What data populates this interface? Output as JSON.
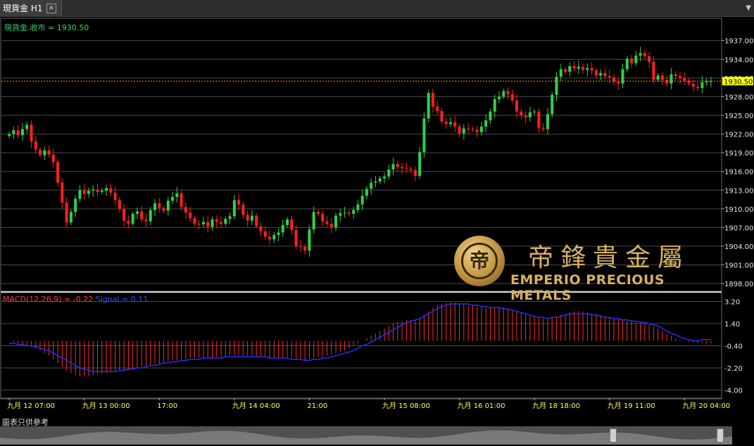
{
  "window": {
    "tab_title": "現貨金 H1",
    "close_glyph": "×",
    "menu_glyph": "▼"
  },
  "legend": {
    "price": "現貨金.收市 = 1930.50",
    "macd": "MACD(12,26,9) = -0.22",
    "signal": "Signal = 0.11"
  },
  "watermark": {
    "logo_glyph": "帝",
    "chinese": "帝鋒貴金屬",
    "english": "EMPERIO PRECIOUS METALS"
  },
  "footer": {
    "note": "圖表只供參考"
  },
  "colors": {
    "up": "#2fd14a",
    "down": "#ff1f1f",
    "grid": "#4a4a4a",
    "axis_text": "#e6e6e6",
    "current_price_bg": "#ffff00",
    "current_price_line": "#ff8c1a",
    "macd_hist": "#ff2a2a",
    "signal_line": "#1f2fff",
    "date_text": "#ffff66"
  },
  "chart_data": [
    {
      "type": "candlestick",
      "title": "現貨金 H1",
      "ylim": [
        1897,
        1939
      ],
      "y_ticks": [
        1937.0,
        1934.0,
        1931.0,
        1928.0,
        1925.0,
        1922.0,
        1919.0,
        1916.0,
        1913.0,
        1910.0,
        1907.0,
        1904.0,
        1901.0,
        1898.0
      ],
      "current_price": 1930.5,
      "current_price_label": "1930.50",
      "x_tick_labels": [
        "九月 12 07:00",
        "九月 13 00:00",
        "17:00",
        "九月 14 04:00",
        "21:00",
        "九月 15 08:00",
        "九月 16 01:00",
        "九月 18 18:00",
        "九月 19 11:00",
        "九月 20 04:00"
      ],
      "x_tick_index": [
        0,
        17,
        34,
        51,
        68,
        85,
        102,
        119,
        136,
        153
      ],
      "closes": [
        1922.0,
        1922.6,
        1921.8,
        1922.8,
        1923.5,
        1920.8,
        1919.5,
        1918.6,
        1919.4,
        1918.7,
        1917.5,
        1914.2,
        1911.0,
        1907.8,
        1909.5,
        1911.6,
        1913.0,
        1912.4,
        1912.9,
        1913.1,
        1912.7,
        1912.9,
        1913.3,
        1912.6,
        1911.4,
        1910.0,
        1908.1,
        1907.6,
        1909.2,
        1909.6,
        1908.3,
        1908.0,
        1909.8,
        1910.9,
        1910.1,
        1909.7,
        1911.3,
        1911.9,
        1912.5,
        1910.3,
        1909.4,
        1908.5,
        1907.6,
        1907.5,
        1907.9,
        1907.1,
        1908.3,
        1907.9,
        1907.6,
        1908.4,
        1908.8,
        1911.4,
        1910.7,
        1909.0,
        1908.1,
        1908.9,
        1907.2,
        1906.4,
        1905.5,
        1905.1,
        1905.8,
        1906.2,
        1907.4,
        1908.3,
        1906.6,
        1904.0,
        1903.9,
        1903.3,
        1906.7,
        1909.5,
        1909.2,
        1908.0,
        1907.6,
        1907.0,
        1908.9,
        1909.3,
        1909.4,
        1909.2,
        1909.8,
        1910.7,
        1912.1,
        1913.2,
        1914.2,
        1914.4,
        1914.9,
        1915.2,
        1916.3,
        1917.2,
        1916.7,
        1916.5,
        1916.4,
        1916.2,
        1915.3,
        1919.1,
        1924.5,
        1928.6,
        1926.4,
        1925.7,
        1924.0,
        1923.6,
        1923.9,
        1923.2,
        1922.1,
        1922.9,
        1922.8,
        1922.7,
        1922.3,
        1923.2,
        1924.2,
        1925.6,
        1927.6,
        1928.0,
        1928.9,
        1928.4,
        1927.4,
        1925.6,
        1925.0,
        1924.7,
        1925.5,
        1925.6,
        1923.0,
        1922.8,
        1925.2,
        1928.3,
        1931.2,
        1932.4,
        1932.0,
        1932.9,
        1932.5,
        1932.8,
        1932.3,
        1932.6,
        1932.2,
        1931.4,
        1931.8,
        1931.3,
        1931.1,
        1930.4,
        1930.1,
        1932.4,
        1934.1,
        1933.4,
        1934.6,
        1935.0,
        1934.5,
        1933.6,
        1930.7,
        1931.4,
        1930.7,
        1930.1,
        1931.6,
        1931.3,
        1931.0,
        1930.6,
        1930.1,
        1929.6,
        1929.4,
        1930.3,
        1930.5,
        1930.5
      ],
      "macd": {
        "ylim": [
          -4.6,
          3.8
        ],
        "y_ticks": [
          3.2,
          1.4,
          -0.4,
          -2.2,
          -4.0
        ],
        "series": [
          {
            "name": "MACD(12,26,9)",
            "values": [
              0.0,
              -0.1,
              -0.2,
              -0.3,
              -0.4,
              -0.5,
              -0.6,
              -0.8,
              -1.0,
              -1.2,
              -1.5,
              -1.8,
              -2.1,
              -2.4,
              -2.6,
              -2.8,
              -2.9,
              -2.9,
              -2.9,
              -2.8,
              -2.7,
              -2.7,
              -2.6,
              -2.5,
              -2.5,
              -2.4,
              -2.4,
              -2.4,
              -2.3,
              -2.2,
              -2.1,
              -2.1,
              -2.0,
              -1.9,
              -1.9,
              -1.8,
              -1.7,
              -1.6,
              -1.6,
              -1.5,
              -1.5,
              -1.4,
              -1.4,
              -1.4,
              -1.4,
              -1.4,
              -1.4,
              -1.3,
              -1.3,
              -1.3,
              -1.2,
              -1.2,
              -1.2,
              -1.2,
              -1.2,
              -1.2,
              -1.3,
              -1.3,
              -1.3,
              -1.4,
              -1.4,
              -1.4,
              -1.4,
              -1.4,
              -1.4,
              -1.5,
              -1.5,
              -1.6,
              -1.5,
              -1.4,
              -1.3,
              -1.3,
              -1.2,
              -1.1,
              -1.0,
              -0.9,
              -0.8,
              -0.6,
              -0.4,
              -0.2,
              0.0,
              0.2,
              0.4,
              0.6,
              0.8,
              1.0,
              1.2,
              1.4,
              1.5,
              1.6,
              1.7,
              1.7,
              1.7,
              1.8,
              2.1,
              2.4,
              2.7,
              2.9,
              3.0,
              3.1,
              3.1,
              3.1,
              3.0,
              3.0,
              2.9,
              2.9,
              2.8,
              2.8,
              2.7,
              2.7,
              2.7,
              2.7,
              2.7,
              2.6,
              2.5,
              2.4,
              2.3,
              2.2,
              2.1,
              2.0,
              1.9,
              1.8,
              1.8,
              1.9,
              2.0,
              2.1,
              2.2,
              2.3,
              2.4,
              2.4,
              2.4,
              2.3,
              2.2,
              2.2,
              2.1,
              2.0,
              1.9,
              1.8,
              1.8,
              1.7,
              1.6,
              1.6,
              1.5,
              1.5,
              1.4,
              1.3,
              1.2,
              1.0,
              0.8,
              0.6,
              0.4,
              0.2,
              0.1,
              0.0,
              -0.1,
              -0.1,
              -0.2,
              -0.2,
              -0.2,
              -0.2
            ]
          },
          {
            "name": "Signal",
            "values": [
              -0.2,
              -0.2,
              -0.3,
              -0.3,
              -0.4,
              -0.4,
              -0.5,
              -0.6,
              -0.7,
              -0.8,
              -1.0,
              -1.2,
              -1.4,
              -1.6,
              -1.8,
              -2.0,
              -2.2,
              -2.3,
              -2.4,
              -2.5,
              -2.5,
              -2.5,
              -2.5,
              -2.5,
              -2.5,
              -2.4,
              -2.4,
              -2.3,
              -2.3,
              -2.2,
              -2.2,
              -2.1,
              -2.0,
              -2.0,
              -1.9,
              -1.8,
              -1.8,
              -1.7,
              -1.7,
              -1.6,
              -1.6,
              -1.5,
              -1.5,
              -1.5,
              -1.4,
              -1.4,
              -1.4,
              -1.4,
              -1.4,
              -1.3,
              -1.3,
              -1.3,
              -1.3,
              -1.3,
              -1.3,
              -1.3,
              -1.3,
              -1.3,
              -1.3,
              -1.4,
              -1.4,
              -1.4,
              -1.4,
              -1.4,
              -1.5,
              -1.5,
              -1.5,
              -1.6,
              -1.6,
              -1.5,
              -1.5,
              -1.4,
              -1.4,
              -1.3,
              -1.2,
              -1.1,
              -1.0,
              -0.9,
              -0.8,
              -0.6,
              -0.4,
              -0.3,
              -0.1,
              0.1,
              0.3,
              0.5,
              0.7,
              0.9,
              1.1,
              1.3,
              1.5,
              1.6,
              1.7,
              1.8,
              2.0,
              2.2,
              2.4,
              2.6,
              2.8,
              2.9,
              3.0,
              3.0,
              3.0,
              3.0,
              3.0,
              2.9,
              2.9,
              2.8,
              2.8,
              2.7,
              2.7,
              2.7,
              2.6,
              2.6,
              2.5,
              2.4,
              2.3,
              2.2,
              2.1,
              2.0,
              1.9,
              1.9,
              1.8,
              1.9,
              1.9,
              2.0,
              2.1,
              2.2,
              2.2,
              2.2,
              2.2,
              2.2,
              2.1,
              2.1,
              2.0,
              1.9,
              1.9,
              1.8,
              1.8,
              1.7,
              1.7,
              1.6,
              1.6,
              1.5,
              1.5,
              1.4,
              1.3,
              1.2,
              1.0,
              0.8,
              0.6,
              0.5,
              0.3,
              0.2,
              0.1,
              0.0,
              0.0,
              0.1,
              0.1,
              0.1
            ]
          }
        ]
      }
    }
  ]
}
